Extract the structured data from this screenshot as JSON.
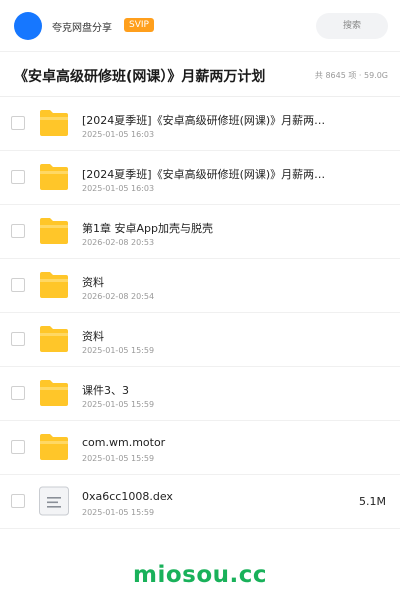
{
  "header": {
    "share_title": "夸克网盘分享",
    "vip_badge": "SVIP",
    "search_label": "搜索",
    "colors": {
      "avatar": "#1677ff",
      "vip": "#ff9f1c"
    }
  },
  "title_row": {
    "title": "《安卓高级研修班(网课）》月薪两万计划",
    "summary": "共 8645 项 · 59.0G"
  },
  "files": [
    {
      "icon": "folder-icon",
      "name": "[2024夏季班]《安卓高级研修班(网课)》月薪两…",
      "date": "2025-01-05 16:03",
      "size": ""
    },
    {
      "icon": "folder-icon",
      "name": "[2024夏季班]《安卓高级研修班(网课)》月薪两…",
      "date": "2025-01-05 16:03",
      "size": ""
    },
    {
      "icon": "folder-icon",
      "name": "第1章 安卓App加壳与脱壳",
      "date": "2026-02-08 20:53",
      "size": ""
    },
    {
      "icon": "folder-icon",
      "name": "资料",
      "date": "2026-02-08 20:54",
      "size": ""
    },
    {
      "icon": "folder-icon",
      "name": "资料",
      "date": "2025-01-05 15:59",
      "size": ""
    },
    {
      "icon": "folder-icon",
      "name": "课件3、3",
      "date": "2025-01-05 15:59",
      "size": ""
    },
    {
      "icon": "folder-icon",
      "name": "com.wm.motor",
      "date": "2025-01-05 15:59",
      "size": ""
    },
    {
      "icon": "file-icon",
      "name": "0xa6cc1008.dex",
      "date": "2025-01-05 15:59",
      "size": "5.1M"
    }
  ],
  "watermark": "miosou.cc"
}
